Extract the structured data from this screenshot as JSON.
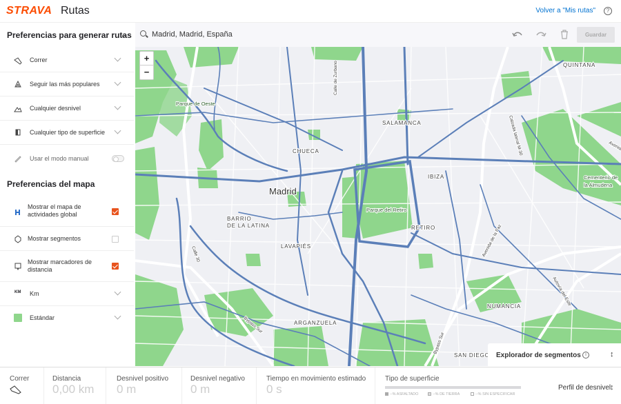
{
  "header": {
    "logo": "STRAVA",
    "title": "Rutas",
    "back_link": "Volver a \"Mis rutas\"",
    "help_glyph": "?"
  },
  "sidebar": {
    "route_prefs_title": "Preferencias para generar rutas",
    "collapse_glyph": "←",
    "route_prefs": [
      {
        "label": "Correr",
        "icon": "shoe-icon"
      },
      {
        "label": "Seguir las más populares",
        "icon": "heat-icon"
      },
      {
        "label": "Cualquier desnivel",
        "icon": "elevation-icon"
      },
      {
        "label": "Cualquier tipo de superficie",
        "icon": "surface-icon"
      }
    ],
    "manual_mode": {
      "label": "Usar el modo manual",
      "icon": "pencil-icon",
      "on": false
    },
    "map_prefs_title": "Preferencias del mapa",
    "map_prefs": [
      {
        "label": "Mostrar el mapa de actividades global",
        "checked": true,
        "icon": "heatmap-icon"
      },
      {
        "label": "Mostrar segmentos",
        "checked": false,
        "icon": "segment-icon"
      },
      {
        "label": "Mostrar marcadores de distancia",
        "checked": true,
        "icon": "marker-icon"
      }
    ],
    "units": {
      "label": "Km",
      "icon_text": "KM"
    },
    "map_style": {
      "label": "Estándar",
      "icon": "map-style-icon"
    }
  },
  "search": {
    "value": "Madrid, Madrid, España",
    "save_label": "Guardar",
    "undo_icon": "undo-icon",
    "redo_icon": "redo-icon",
    "delete_icon": "trash-icon"
  },
  "map": {
    "zoom_in": "+",
    "zoom_out": "−",
    "labels": [
      {
        "text": "Madrid",
        "cls": "city"
      },
      {
        "text": "Parque de Oeste",
        "cls": "park"
      },
      {
        "text": "SALAMANCA",
        "cls": "dist"
      },
      {
        "text": "CHUECA",
        "cls": "dist"
      },
      {
        "text": "IBIZA",
        "cls": "dist"
      },
      {
        "text": "Parque del Retiro",
        "cls": "park"
      },
      {
        "text": "RETIRO",
        "cls": "dist"
      },
      {
        "text": "BARRIO",
        "cls": "dist"
      },
      {
        "text": "DE LA LATINA",
        "cls": "dist"
      },
      {
        "text": "LAVAPIÉS",
        "cls": "dist"
      },
      {
        "text": "QUINTANA",
        "cls": "dist"
      },
      {
        "text": "Cementerio de",
        "cls": "park"
      },
      {
        "text": "la Almudena",
        "cls": "park"
      },
      {
        "text": "ARGANZUELA",
        "cls": "dist"
      },
      {
        "text": "NUMANCIA",
        "cls": "dist"
      },
      {
        "text": "SAN DIEGO",
        "cls": "dist"
      },
      {
        "text": "Calle de Zurbano",
        "cls": "street"
      },
      {
        "text": "Calzada lateral M-30",
        "cls": "street"
      },
      {
        "text": "Calle 30",
        "cls": "street"
      },
      {
        "text": "Bypass Sur",
        "cls": "street"
      },
      {
        "text": "Bypass Sur",
        "cls": "street"
      },
      {
        "text": "Avenida de la Paz",
        "cls": "street"
      },
      {
        "text": "Autovía del Este",
        "cls": "street"
      },
      {
        "text": "Avenida",
        "cls": "street"
      }
    ],
    "colors": {
      "background": "#eff0f4",
      "park": "#8fd68c",
      "heat": "#5b7fb8",
      "road": "#ffffff"
    }
  },
  "explorer": {
    "label": "Explorador de segmentos",
    "info_glyph": "i",
    "toggle_glyph": "↕"
  },
  "stats": {
    "activity": {
      "label": "Correr",
      "icon": "shoe-icon"
    },
    "items": [
      {
        "label": "Distancia",
        "value": "0,00 km"
      },
      {
        "label": "Desnivel positivo",
        "value": "0 m"
      },
      {
        "label": "Desnivel negativo",
        "value": "0 m"
      },
      {
        "label": "Tiempo en movimiento estimado",
        "value": "0 s"
      }
    ],
    "surface": {
      "label": "Tipo de superficie",
      "legend": [
        "--% ASFALTADO",
        "--% DE TIERRA",
        "--% SIN ESPECIFICAR"
      ]
    },
    "profile": {
      "label": "Perfil de desnivel",
      "toggle_glyph": "↕"
    }
  }
}
